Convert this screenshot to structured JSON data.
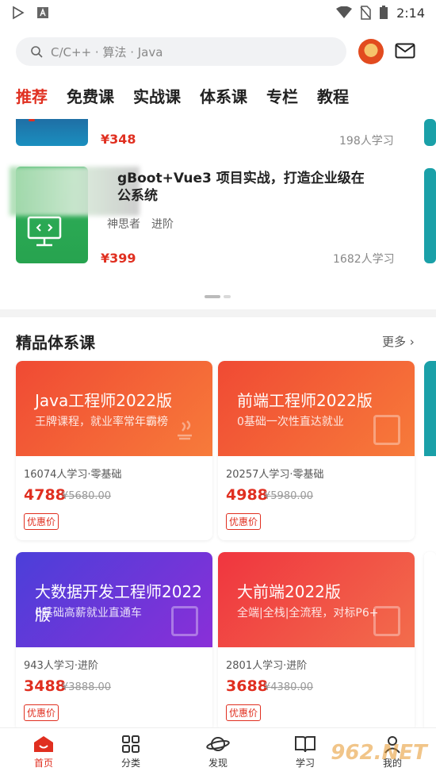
{
  "status": {
    "time": "2:14"
  },
  "search": {
    "placeholder": "C/C++ · 算法 · Java"
  },
  "tabs": [
    "推荐",
    "免费课",
    "实战课",
    "体系课",
    "专栏",
    "教程"
  ],
  "recommend": {
    "item1": {
      "price": "¥348",
      "learners": "198人学习"
    },
    "item2": {
      "title": "gBoot+Vue3 项目实战，打造企业级在线办公系统",
      "title_line1": "gBoot+Vue3 项目实战，打造企业级在",
      "title_line2": "公系统",
      "teacher": "神思者",
      "level": "进阶",
      "price": "¥399",
      "learners": "1682人学习"
    }
  },
  "system": {
    "title": "精品体系课",
    "more": "更多",
    "cards": [
      {
        "banner_title": "Java工程师2022版",
        "banner_sub": "王牌课程，就业率常年霸榜",
        "stat": "16074人学习·零基础",
        "price": "4788",
        "orig": "¥5680.00",
        "tag": "优惠价",
        "color_from": "#f04a34",
        "color_to": "#f77b3a"
      },
      {
        "banner_title": "前端工程师2022版",
        "banner_sub": "0基础一次性直达就业",
        "stat": "20257人学习·零基础",
        "price": "4988",
        "orig": "¥5980.00",
        "tag": "优惠价",
        "color_from": "#f04a34",
        "color_to": "#f77b3a"
      },
      {
        "banner_title": "大数据开发工程师2022版",
        "banner_sub": "0基础高薪就业直通车",
        "stat": "943人学习·进阶",
        "price": "3488",
        "orig": "¥3888.00",
        "tag": "优惠价",
        "color_from": "#4b3fd9",
        "color_to": "#8a2fd8"
      },
      {
        "banner_title": "大前端2022版",
        "banner_sub": "全端|全栈|全流程，对标P6+",
        "stat": "2801人学习·进阶",
        "price": "3688",
        "orig": "¥4380.00",
        "tag": "优惠价",
        "color_from": "#f0353f",
        "color_to": "#f26d4c"
      }
    ]
  },
  "nav": [
    {
      "label": "首页",
      "icon": "home-icon"
    },
    {
      "label": "分类",
      "icon": "grid-icon"
    },
    {
      "label": "发现",
      "icon": "planet-icon"
    },
    {
      "label": "学习",
      "icon": "book-icon"
    },
    {
      "label": "我的",
      "icon": "user-icon"
    }
  ],
  "watermark": "962.NET 乐游网",
  "colors": {
    "accent": "#e02f20"
  }
}
